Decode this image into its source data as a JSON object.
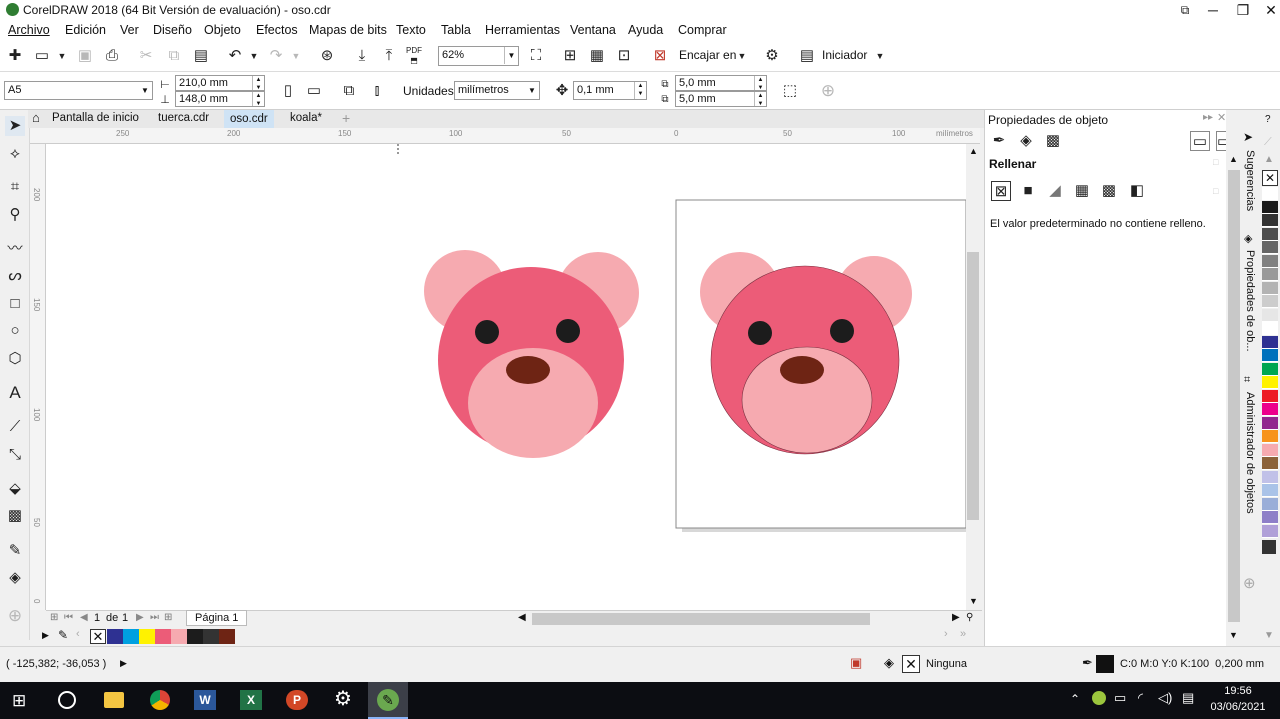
{
  "window": {
    "title": "CorelDRAW 2018 (64 Bit Versión de evaluación) - oso.cdr",
    "minimize_glyph": "─",
    "maximize_glyph": "❐",
    "close_glyph": "✕"
  },
  "menu": {
    "items": [
      "Archivo",
      "Edición",
      "Ver",
      "Diseño",
      "Objeto",
      "Efectos",
      "Mapas de bits",
      "Texto",
      "Tabla",
      "Herramientas",
      "Ventana",
      "Ayuda",
      "Comprar"
    ]
  },
  "toolbar": {
    "zoom_value": "62%",
    "fit_label": "Encajar en",
    "launcher_label": "Iniciador"
  },
  "propbar": {
    "page_size": "A5",
    "width": "210,0 mm",
    "height": "148,0 mm",
    "units_label": "Unidades:",
    "units_value": "milímetros",
    "nudge": "0,1 mm",
    "dup_x": "5,0 mm",
    "dup_y": "5,0 mm"
  },
  "tabs": [
    "Pantalla de inicio",
    "tuerca.cdr",
    "oso.cdr",
    "koala*"
  ],
  "ruler": {
    "ticks": [
      "250",
      "200",
      "150",
      "100",
      "50",
      "0",
      "50",
      "100"
    ],
    "unit": "milímetros",
    "v_ticks": [
      "200",
      "150",
      "100",
      "50",
      "0"
    ]
  },
  "page_nav": {
    "current": "1",
    "of": "de",
    "total": "1",
    "page_tab": "Página 1"
  },
  "panel": {
    "title": "Propiedades de objeto",
    "section": "Rellenar",
    "message": "El valor predeterminado no contiene relleno."
  },
  "side_tabs": [
    "Sugerencias",
    "Propiedades de ob...",
    "Administrador de objetos"
  ],
  "status": {
    "coords": "( -125,382; -36,053 )",
    "fill_label": "Ninguna",
    "outline_label": "C:0 M:0 Y:0 K:100  0,200 mm"
  },
  "clock": {
    "time": "19:56",
    "date": "03/06/2021"
  },
  "colors": {
    "bear_face": "#ec5c78",
    "bear_ear": "#f6aab0",
    "bear_muzzle": "#f6aab0",
    "bear_eye": "#1c1c1c",
    "bear_nose": "#6e2414"
  },
  "palette": [
    "#ffffff",
    "#1a1a1a",
    "#333333",
    "#4d4d4d",
    "#666666",
    "#808080",
    "#999999",
    "#b3b3b3",
    "#cccccc",
    "#e6e6e6",
    "#ffffff",
    "#2e3192",
    "#0071bc",
    "#00a651",
    "#fff200",
    "#ed1c24",
    "#ec008c",
    "#92278f",
    "#f7941d",
    "#f6aab0",
    "#8c6239",
    "#c1c1e8",
    "#aac3e8",
    "#9aaed8",
    "#8e7fc8",
    "#b0a0d8"
  ],
  "doc_palette": [
    "#2e3192",
    "#00a0e0",
    "#fff200",
    "#ec5c78",
    "#f6aab0",
    "#1c1c1c",
    "#333333",
    "#6e2414"
  ]
}
